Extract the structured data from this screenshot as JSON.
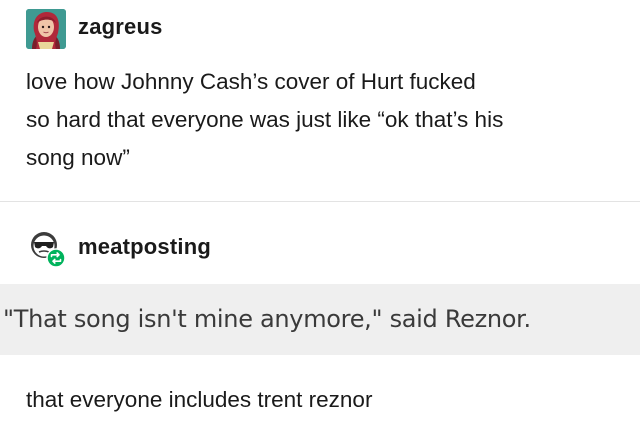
{
  "posts": [
    {
      "username": "zagreus",
      "avatar_icon": "illustrated-portrait-avatar-icon",
      "lines": [
        "love how Johnny Cash’s cover of Hurt fucked",
        "so hard that everyone was just like “ok that’s his",
        "song now”"
      ]
    },
    {
      "username": "meatposting",
      "avatar_icon": "sunglasses-face-avatar-icon",
      "reblog_badge_icon": "reblog-arrows-icon",
      "quote": "\"That song isn't mine anymore,\" said Reznor.",
      "text": "that everyone includes trent reznor"
    }
  ],
  "colors": {
    "text": "#1a1a1a",
    "divider": "#e3e3e3",
    "quote_background": "#efefef",
    "reblog_badge": "#00b35c"
  }
}
